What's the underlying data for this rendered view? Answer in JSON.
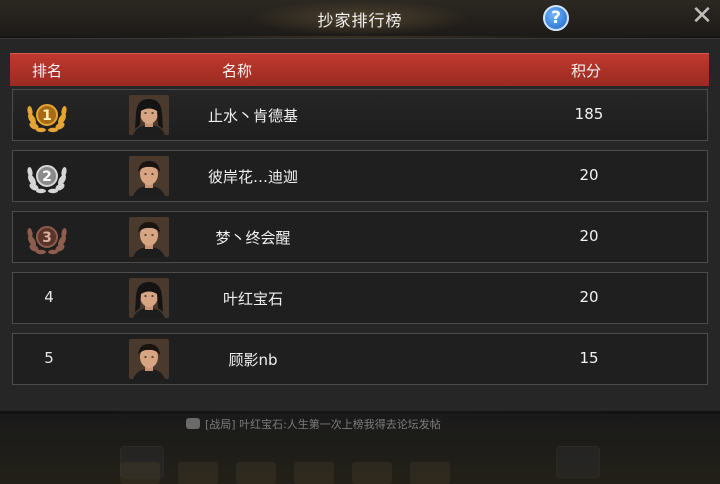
{
  "window": {
    "title": "抄家排行榜"
  },
  "header": {
    "rank": "排名",
    "name": "名称",
    "score": "积分"
  },
  "rows": [
    {
      "rank": "1",
      "name": "止水丶肯德基",
      "score": "185",
      "medal": "gold",
      "hair": "long"
    },
    {
      "rank": "2",
      "name": "彼岸花…迪迦",
      "score": "20",
      "medal": "silver",
      "hair": "short"
    },
    {
      "rank": "3",
      "name": "梦丶终会醒",
      "score": "20",
      "medal": "bronze",
      "hair": "short"
    },
    {
      "rank": "4",
      "name": "叶红宝石",
      "score": "20",
      "medal": null,
      "hair": "long"
    },
    {
      "rank": "5",
      "name": "顾影nb",
      "score": "15",
      "medal": null,
      "hair": "short"
    }
  ],
  "chat": {
    "text": "[战局] 叶红宝石:人生第一次上榜我得去论坛发帖"
  },
  "colors": {
    "header": "#b03228",
    "gold": "#d99a2b",
    "silver": "#c9c9c9",
    "bronze": "#8a5a4a"
  }
}
